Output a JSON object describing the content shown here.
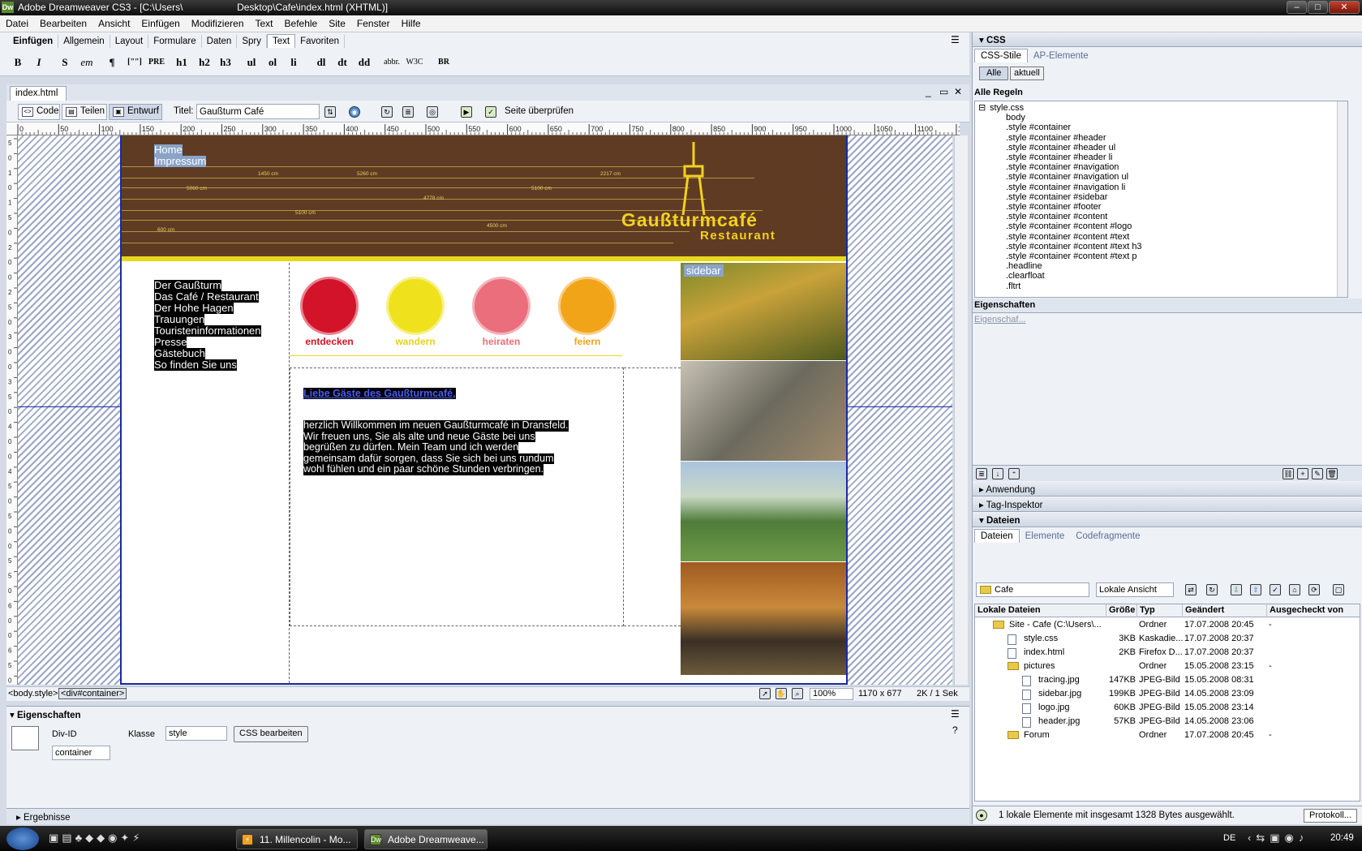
{
  "window": {
    "title": "Adobe Dreamweaver CS3 - [C:\\Users\\                    Desktop\\Cafe\\index.html (XHTML)]",
    "app_badge": "Dw",
    "minimize": "–",
    "maximize": "□",
    "close": "✕"
  },
  "menu": [
    "Datei",
    "Bearbeiten",
    "Ansicht",
    "Einfügen",
    "Modifizieren",
    "Text",
    "Befehle",
    "Site",
    "Fenster",
    "Hilfe"
  ],
  "insert_bar": {
    "title": "Einfügen",
    "tabs": [
      "Allgemein",
      "Layout",
      "Formulare",
      "Daten",
      "Spry",
      "Text",
      "Favoriten"
    ],
    "active_tab": "Text",
    "buttons": [
      "B",
      "I",
      "S",
      "em",
      "¶",
      "[\"\"]",
      "PRE",
      "h1",
      "h2",
      "h3",
      "ul",
      "ol",
      "li",
      "dl",
      "dt",
      "dd",
      "abbr.",
      "W3C",
      "BR"
    ]
  },
  "document": {
    "tab": "index.html",
    "views": [
      "Code",
      "Teilen",
      "Entwurf"
    ],
    "active_view": "Entwurf",
    "title_label": "Titel:",
    "title_value": "Gaußturm Café",
    "check_page": "Seite überprüfen",
    "win_min": "_",
    "win_max": "▭",
    "win_close": "✕"
  },
  "ruler_marks": [
    "0",
    "50",
    "100",
    "150",
    "200",
    "250",
    "300",
    "350",
    "400",
    "450",
    "500",
    "550",
    "600",
    "650",
    "700",
    "750",
    "800",
    "850",
    "900",
    "950",
    "1000",
    "1050",
    "1100",
    "1150"
  ],
  "ruler_v_marks": [
    "5",
    "0",
    "1",
    "0",
    "1",
    "5",
    "0",
    "2",
    "0",
    "0",
    "2",
    "5",
    "0",
    "3",
    "0",
    "0",
    "3",
    "5",
    "0",
    "4",
    "0",
    "0",
    "4",
    "5",
    "0",
    "5",
    "0",
    "0",
    "5",
    "5",
    "0",
    "6",
    "0",
    "0",
    "6",
    "5",
    "0"
  ],
  "page": {
    "top_nav": [
      "Home",
      "Impressum"
    ],
    "header_labels": [
      "1450 cm",
      "5260 cm",
      "2217 cm",
      "5060 cm",
      "4778 cm",
      "5100 cm",
      "5100 cm",
      "4500 cm",
      "600 cm"
    ],
    "logo_line1": "Gaußturmcafé",
    "logo_line2": "Restaurant",
    "side_nav": [
      "Der Gaußturm",
      "Das Café / Restaurant",
      "Der Hohe Hagen",
      "Trauungen",
      "Touristeninformationen",
      "Presse",
      "Gästebuch",
      "So finden Sie uns"
    ],
    "badges": [
      {
        "label": "entdecken",
        "color": "#d2132a"
      },
      {
        "label": "wandern",
        "color": "#efe21c"
      },
      {
        "label": "heiraten",
        "color": "#ea6e7b"
      },
      {
        "label": "feiern",
        "color": "#f2a418"
      }
    ],
    "sidebar_label": "sidebar",
    "headline": "Liebe Gäste des Gaußturmcafé,",
    "body_lines": [
      "herzlich Willkommen im neuen Gaußturmcafé in Dransfeld.",
      "Wir freuen uns, Sie als alte und neue Gäste bei uns",
      "begrüßen zu dürfen. Mein Team und ich werden",
      "gemeinsam dafür sorgen, dass Sie sich bei uns rundum",
      "wohl fühlen und ein paar schöne Stunden verbringen."
    ]
  },
  "tagbar": {
    "tags": [
      "<body.style>",
      "<div#container>"
    ],
    "zoom": "100%",
    "size": "1170 x 677",
    "download": "2K / 1 Sek"
  },
  "properties": {
    "title": "Eigenschaften",
    "div_id_label": "Div-ID",
    "class_label": "Klasse",
    "class_value": "style",
    "edit_css": "CSS bearbeiten",
    "div_id_value": "container"
  },
  "results": {
    "title": "Ergebnisse"
  },
  "css_panel": {
    "title": "CSS",
    "tabs": [
      "CSS-Stile",
      "AP-Elemente"
    ],
    "buttons": [
      "Alle",
      "aktuell"
    ],
    "rules_header": "Alle Regeln",
    "rules": [
      "style.css",
      "body",
      ".style #container",
      ".style #container #header",
      ".style #container #header ul",
      ".style #container #header li",
      ".style #container #navigation",
      ".style #container #navigation ul",
      ".style #container #navigation li",
      ".style #container #sidebar",
      ".style #container #footer",
      ".style #container #content",
      ".style #container #content #logo",
      ".style #container #content #text",
      ".style #container #content #text h3",
      ".style #container #content #text p",
      ".headline",
      ".clearfloat",
      ".fltrt"
    ],
    "props_header": "Eigenschaften",
    "props_link": "Eigenschaf...",
    "collapsed": [
      "Anwendung",
      "Tag-Inspektor"
    ]
  },
  "files_panel": {
    "title": "Dateien",
    "tabs": [
      "Dateien",
      "Elemente",
      "Codefragmente"
    ],
    "site": "Cafe",
    "view": "Lokale Ansicht",
    "columns": [
      "Lokale Dateien",
      "Größe",
      "Typ",
      "Geändert",
      "Ausgecheckt von"
    ],
    "rows": [
      {
        "name": "Site - Cafe (C:\\Users\\...",
        "size": "",
        "type": "Ordner",
        "modified": "17.07.2008 20:45",
        "checked": "-",
        "kind": "folder",
        "indent": 0
      },
      {
        "name": "style.css",
        "size": "3KB",
        "type": "Kaskadie...",
        "modified": "17.07.2008 20:37",
        "checked": "",
        "kind": "file",
        "indent": 1
      },
      {
        "name": "index.html",
        "size": "2KB",
        "type": "Firefox D...",
        "modified": "17.07.2008 20:37",
        "checked": "",
        "kind": "file",
        "indent": 1
      },
      {
        "name": "pictures",
        "size": "",
        "type": "Ordner",
        "modified": "15.05.2008 23:15",
        "checked": "-",
        "kind": "folder",
        "indent": 1
      },
      {
        "name": "tracing.jpg",
        "size": "147KB",
        "type": "JPEG-Bild",
        "modified": "15.05.2008 08:31",
        "checked": "",
        "kind": "file",
        "indent": 2
      },
      {
        "name": "sidebar.jpg",
        "size": "199KB",
        "type": "JPEG-Bild",
        "modified": "14.05.2008 23:09",
        "checked": "",
        "kind": "file",
        "indent": 2
      },
      {
        "name": "logo.jpg",
        "size": "60KB",
        "type": "JPEG-Bild",
        "modified": "15.05.2008 23:14",
        "checked": "",
        "kind": "file",
        "indent": 2
      },
      {
        "name": "header.jpg",
        "size": "57KB",
        "type": "JPEG-Bild",
        "modified": "14.05.2008 23:06",
        "checked": "",
        "kind": "file",
        "indent": 2
      },
      {
        "name": "Forum",
        "size": "",
        "type": "Ordner",
        "modified": "17.07.2008 20:45",
        "checked": "-",
        "kind": "folder",
        "indent": 1
      }
    ],
    "status": "1 lokale Elemente mit insgesamt 1328 Bytes ausgewählt.",
    "log_button": "Protokoll..."
  },
  "taskbar": {
    "tasks": [
      "11. Millencolin - Mo...",
      "Adobe Dreamweave..."
    ],
    "lang": "DE",
    "time": "20:49"
  }
}
